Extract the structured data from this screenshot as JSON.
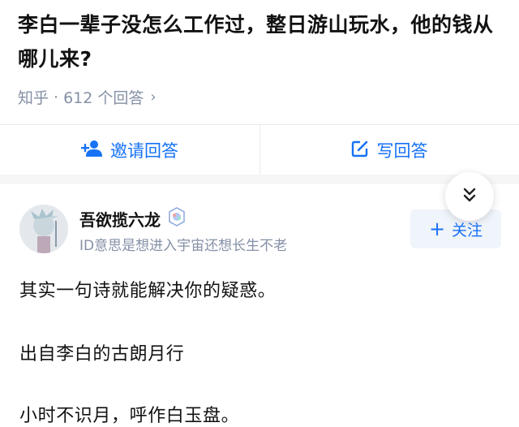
{
  "question": {
    "title": "李白一辈子没怎么工作过，整日游山玩水，他的钱从哪儿来?",
    "source": "知乎",
    "separator": "·",
    "answer_count": "612 个回答",
    "chevron": "›"
  },
  "actions": {
    "invite_label": "邀请回答",
    "invite_icon": "add-user-icon",
    "write_label": "写回答",
    "write_icon": "edit-icon"
  },
  "author": {
    "name": "吾欲揽六龙",
    "bio": "ID意思是想进入宇宙还想长生不老",
    "follow_label": "关注",
    "follow_prefix": "+"
  },
  "answer": {
    "lines": [
      "其实一句诗就能解决你的疑惑。",
      "出自李白的古朗月行",
      "小时不识月，呼作白玉盘。"
    ]
  },
  "colors": {
    "accent": "#1772f6",
    "meta_text": "#8590a6",
    "follow_bg": "#f0f4fb",
    "band": "#f6f6f6"
  }
}
